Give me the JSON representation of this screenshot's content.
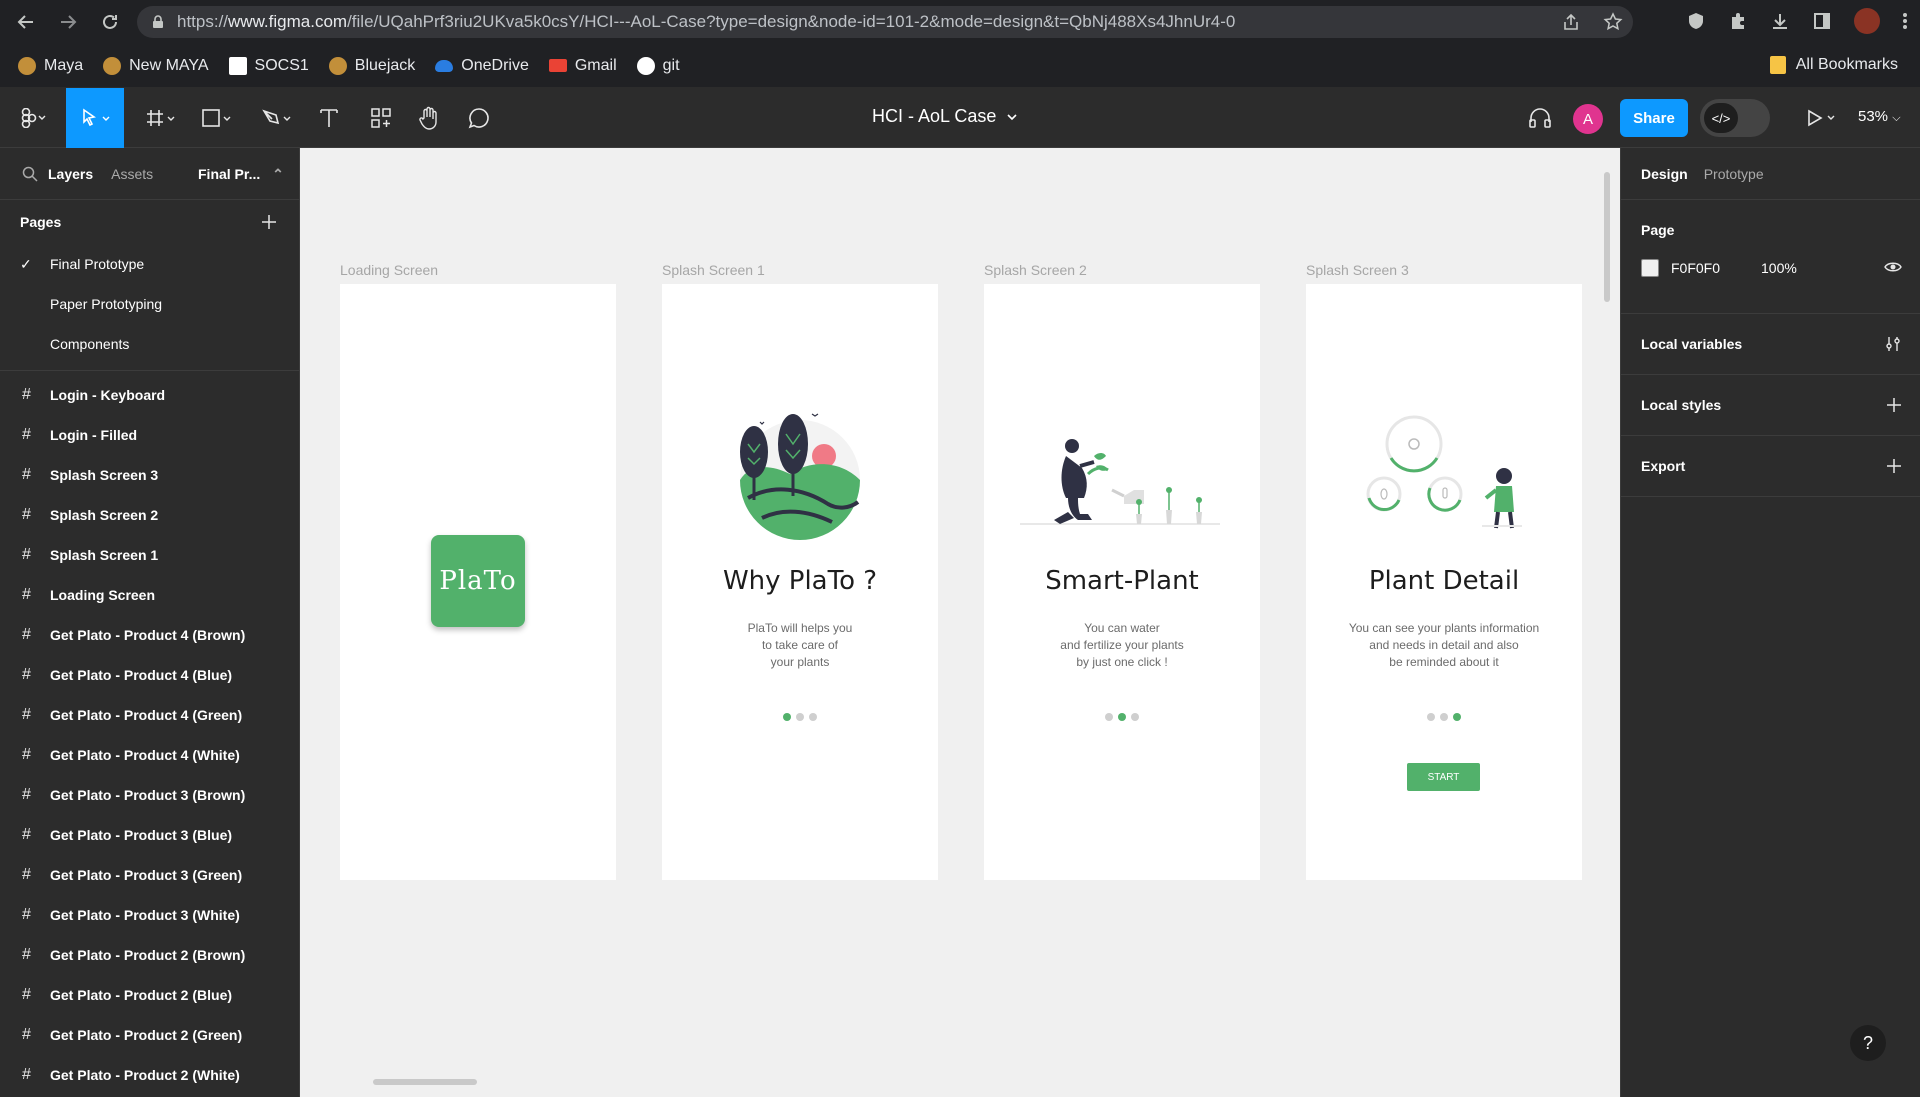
{
  "browser": {
    "url_prefix": "https://",
    "url_domain": "www.figma.com",
    "url_rest": "/file/UQahPrf3riu2UKva5k0csY/HCI---AoL-Case?type=design&node-id=101-2&mode=design&t=QbNj488Xs4JhnUr4-0"
  },
  "bookmarks": {
    "items": [
      "Maya",
      "New MAYA",
      "SOCS1",
      "Bluejack",
      "OneDrive",
      "Gmail",
      "git"
    ],
    "all_label": "All Bookmarks"
  },
  "toolbar": {
    "file_title": "HCI - AoL Case",
    "share_label": "Share",
    "dev_label": "</>",
    "user_initial": "A",
    "zoom": "53%"
  },
  "left_panel": {
    "tabs": {
      "layers": "Layers",
      "assets": "Assets",
      "page": "Final Pr..."
    },
    "pages_header": "Pages",
    "pages": [
      "Final Prototype",
      "Paper Prototyping",
      "Components"
    ],
    "layers": [
      "Login - Keyboard",
      "Login - Filled",
      "Splash Screen 3",
      "Splash Screen 2",
      "Splash Screen 1",
      "Loading Screen",
      "Get Plato - Product 4 (Brown)",
      "Get Plato - Product 4 (Blue)",
      "Get Plato - Product 4 (Green)",
      "Get Plato - Product 4 (White)",
      "Get Plato - Product 3 (Brown)",
      "Get Plato - Product 3 (Blue)",
      "Get Plato - Product 3 (Green)",
      "Get Plato - Product 3 (White)",
      "Get Plato - Product 2 (Brown)",
      "Get Plato - Product 2 (Blue)",
      "Get Plato - Product 2 (Green)",
      "Get Plato - Product 2 (White)"
    ]
  },
  "canvas": {
    "frames": {
      "loading": {
        "label": "Loading Screen",
        "logo": "PlaTo"
      },
      "splash1": {
        "label": "Splash Screen 1",
        "title": "Why PlaTo ?",
        "desc": "PlaTo will helps you\nto take care of\nyour plants"
      },
      "splash2": {
        "label": "Splash Screen 2",
        "title": "Smart-Plant",
        "desc": "You can water\nand fertilize your plants\nby just one click !"
      },
      "splash3": {
        "label": "Splash Screen 3",
        "title": "Plant Detail",
        "desc": "You can see your plants information\nand needs in detail and also\nbe reminded about it",
        "button": "START"
      }
    },
    "colors": {
      "accent_green": "#52b16b",
      "background": "#f0f0f0"
    }
  },
  "right_panel": {
    "tabs": {
      "design": "Design",
      "prototype": "Prototype"
    },
    "page_title": "Page",
    "page_color": "F0F0F0",
    "page_opacity": "100%",
    "local_variables": "Local variables",
    "local_styles": "Local styles",
    "export": "Export"
  },
  "help": "?"
}
